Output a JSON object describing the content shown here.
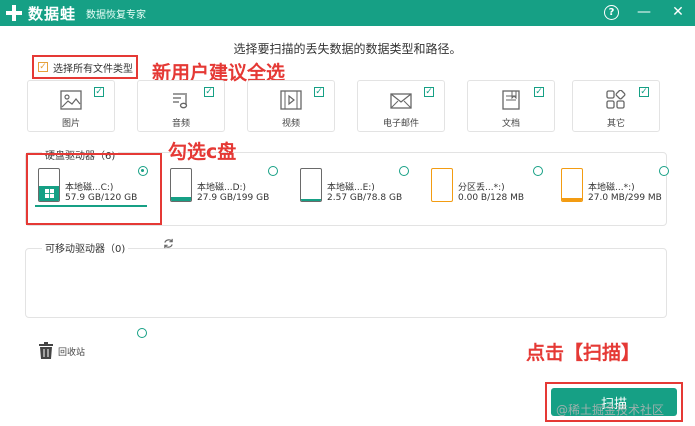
{
  "titlebar": {
    "app_name": "数据蛙",
    "subtitle": "数据恢复专家",
    "help": "?",
    "minimize": "—",
    "close": "✕"
  },
  "instruction": "选择要扫描的丢失数据的数据类型和路径。",
  "select_all": {
    "label": "选择所有文件类型",
    "checked": true
  },
  "annotations": {
    "new_user": "新用户建议全选",
    "pick_c": "勾选c盘",
    "click_scan": "点击【扫描】"
  },
  "file_types": [
    {
      "label": "图片",
      "icon": "image-icon"
    },
    {
      "label": "音频",
      "icon": "music-icon"
    },
    {
      "label": "视频",
      "icon": "video-icon"
    },
    {
      "label": "电子邮件",
      "icon": "mail-icon"
    },
    {
      "label": "文档",
      "icon": "document-icon"
    },
    {
      "label": "其它",
      "icon": "other-icon"
    }
  ],
  "hard_drives": {
    "title": "硬盘驱动器（6)",
    "items": [
      {
        "name": "本地磁...C:)",
        "size": "57.9 GB/120 GB",
        "fill": 0.48,
        "color": "#16a085",
        "selected": true,
        "windows": true
      },
      {
        "name": "本地磁...D:)",
        "size": "27.9 GB/199 GB",
        "fill": 0.14,
        "color": "#16a085",
        "selected": false
      },
      {
        "name": "本地磁...E:)",
        "size": "2.57 GB/78.8 GB",
        "fill": 0.03,
        "color": "#16a085",
        "selected": false
      },
      {
        "name": "分区丢...*:)",
        "size": "0.00  B/128 MB",
        "fill": 0.0,
        "color": "#f39c12",
        "selected": false
      },
      {
        "name": "本地磁...*:)",
        "size": "27.0 MB/299 MB",
        "fill": 0.09,
        "color": "#f39c12",
        "selected": false
      }
    ]
  },
  "removable": {
    "title": "可移动驱动器（0)"
  },
  "recycle_bin": {
    "label": "回收站"
  },
  "scan_button": {
    "label": "扫描"
  },
  "watermark": "@稀土掘金技术社区"
}
